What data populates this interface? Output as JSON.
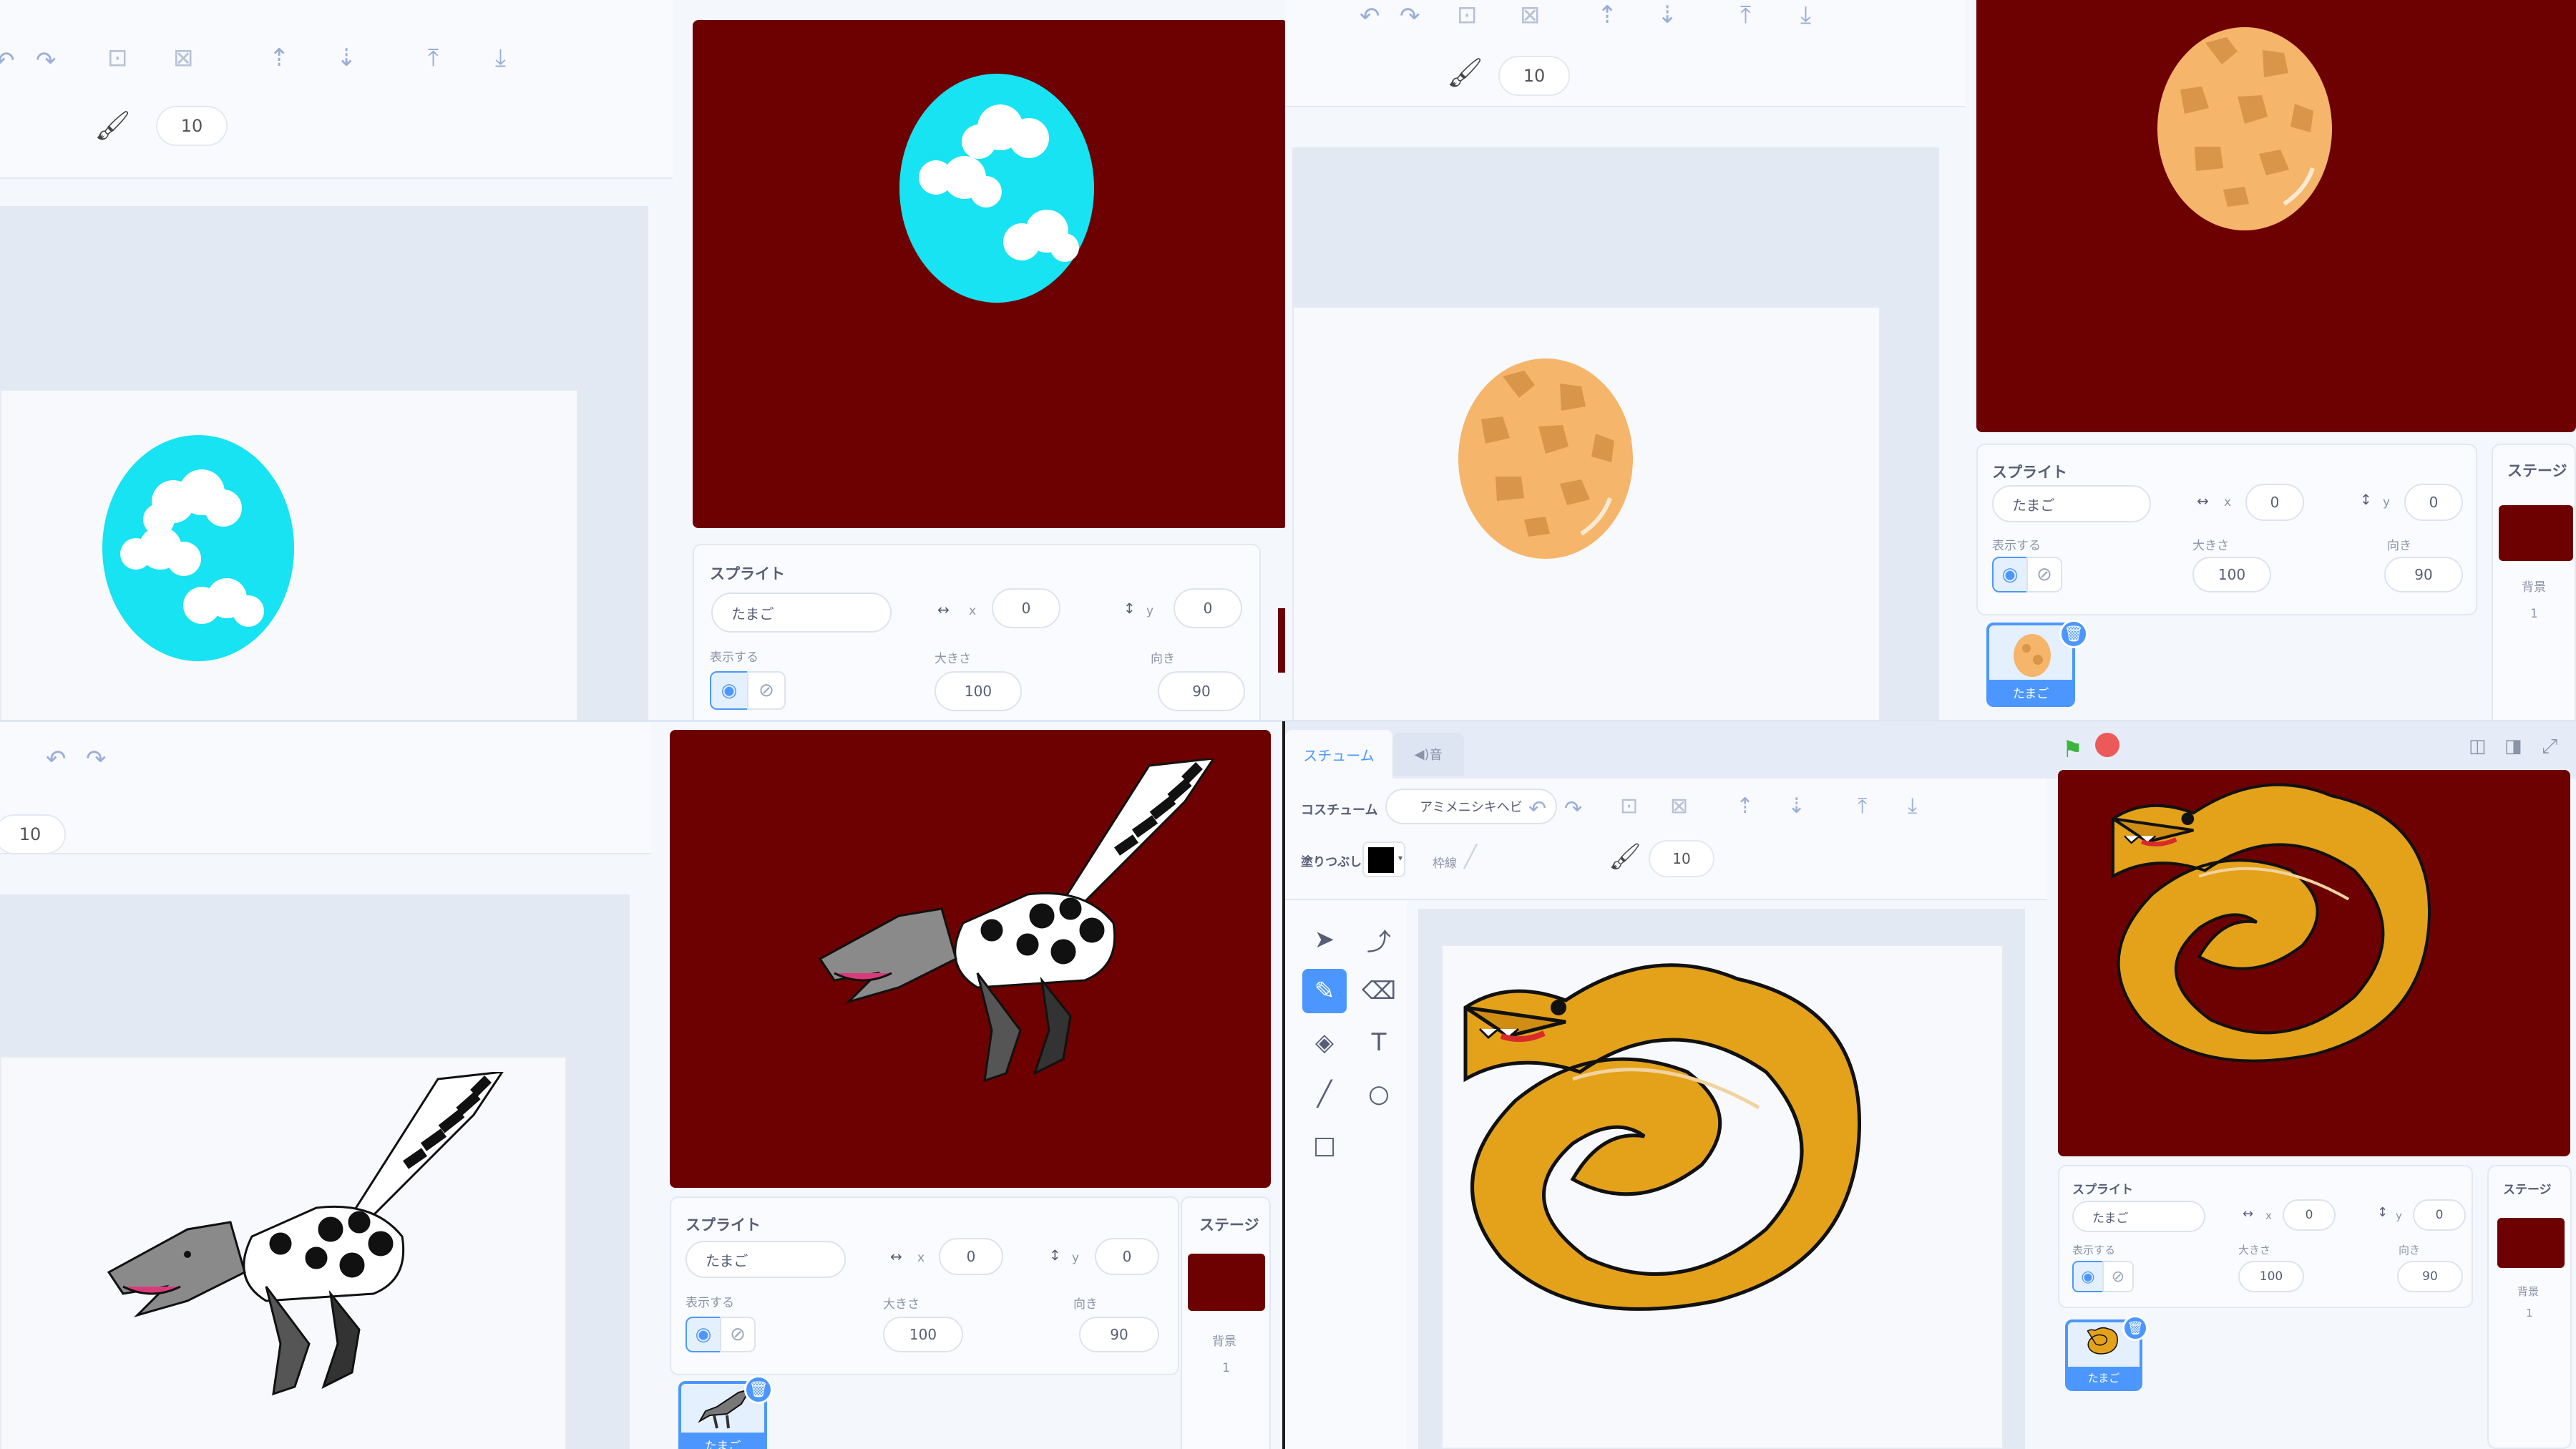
{
  "panels": {
    "sprite_label": "スプライト",
    "sprite_name": "たまご",
    "x_label": "x",
    "y_label": "y",
    "x_value": "0",
    "y_value": "0",
    "show_label": "表示する",
    "size_label": "大きさ",
    "size_value": "100",
    "direction_label": "向き",
    "direction_value": "90",
    "stage_label": "ステージ",
    "backdrop_label": "背景",
    "backdrop_count": "1",
    "brush_size": "10"
  },
  "editor": {
    "tab_costumes": "スチューム",
    "tab_sounds": "音",
    "costume_label": "コスチューム",
    "costume_name": "アミメニシキヘビ",
    "fill_label": "塗りつぶし",
    "outline_label": "枠線"
  },
  "colors": {
    "stage_bg": "#6d0000",
    "accent": "#4c97ff",
    "egg_blue": "#17e3f2",
    "egg_orange": "#f5b56a",
    "snake": "#e4a21b"
  },
  "icons": [
    "undo-icon",
    "redo-icon",
    "group-icon",
    "ungroup-icon",
    "forward-icon",
    "backward-icon",
    "front-icon",
    "back-icon",
    "brush-icon",
    "eye-icon",
    "eye-off-icon",
    "green-flag-icon",
    "stop-icon",
    "trash-icon",
    "select-icon",
    "reshape-icon",
    "brush-tool-icon",
    "eraser-icon",
    "fill-icon",
    "text-icon",
    "line-icon",
    "circle-icon",
    "rect-icon"
  ]
}
